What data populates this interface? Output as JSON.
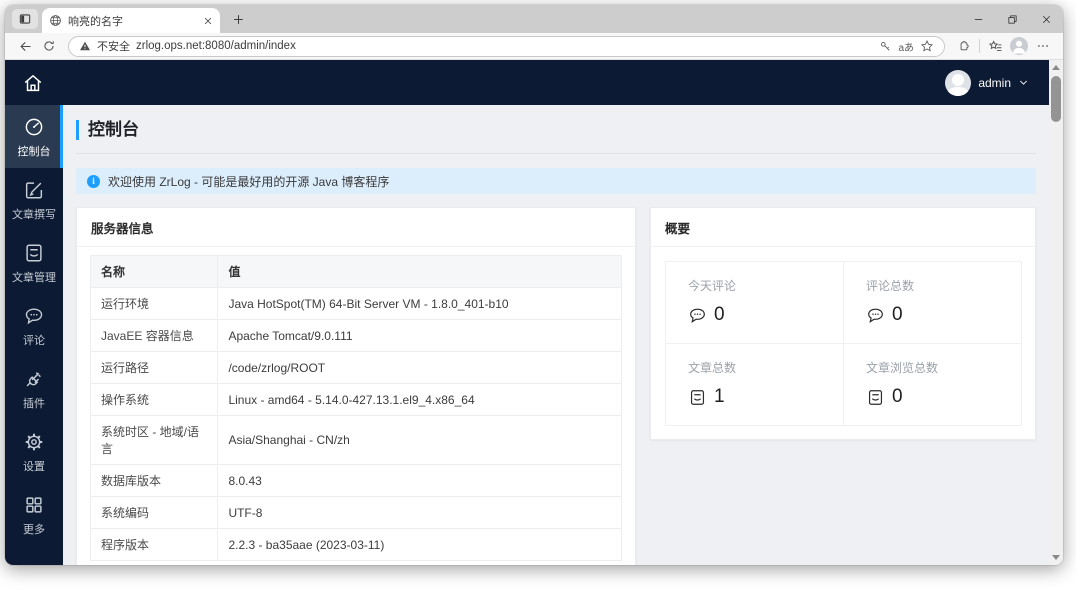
{
  "browser": {
    "tab_title": "响亮的名字",
    "security_label": "不安全",
    "url": "zrlog.ops.net:8080/admin/index",
    "translate_label": "aあ"
  },
  "app_header": {
    "user": "admin"
  },
  "sidebar": {
    "items": [
      {
        "label": "控制台",
        "icon": "gauge-icon",
        "active": true
      },
      {
        "label": "文章撰写",
        "icon": "edit-icon",
        "active": false
      },
      {
        "label": "文章管理",
        "icon": "articles-icon",
        "active": false
      },
      {
        "label": "评论",
        "icon": "comments-icon",
        "active": false
      },
      {
        "label": "插件",
        "icon": "plugin-icon",
        "active": false
      },
      {
        "label": "设置",
        "icon": "gear-icon",
        "active": false
      },
      {
        "label": "更多",
        "icon": "grid-icon",
        "active": false
      }
    ]
  },
  "main": {
    "page_title": "控制台",
    "notice": "欢迎使用 ZrLog - 可能是最好用的开源 Java 博客程序",
    "server_panel": {
      "title": "服务器信息",
      "columns": [
        "名称",
        "值"
      ],
      "rows": [
        [
          "运行环境",
          "Java HotSpot(TM) 64-Bit Server VM - 1.8.0_401-b10"
        ],
        [
          "JavaEE 容器信息",
          "Apache Tomcat/9.0.111"
        ],
        [
          "运行路径",
          "/code/zrlog/ROOT"
        ],
        [
          "操作系统",
          "Linux - amd64 - 5.14.0-427.13.1.el9_4.x86_64"
        ],
        [
          "系统时区 - 地域/语言",
          "Asia/Shanghai - CN/zh"
        ],
        [
          "数据库版本",
          "8.0.43"
        ],
        [
          "系统编码",
          "UTF-8"
        ],
        [
          "程序版本",
          "2.2.3 - ba35aae (2023-03-11)"
        ]
      ]
    },
    "overview_panel": {
      "title": "概要",
      "stats": [
        {
          "label": "今天评论",
          "value": "0",
          "icon": "comment-icon"
        },
        {
          "label": "评论总数",
          "value": "0",
          "icon": "comment-icon"
        },
        {
          "label": "文章总数",
          "value": "1",
          "icon": "article-icon"
        },
        {
          "label": "文章浏览总数",
          "value": "0",
          "icon": "article-icon"
        }
      ]
    }
  },
  "colors": {
    "accent_blue": "#1e9fff",
    "dark_navy": "#0c1b33",
    "active_item_bg": "#2a3a50",
    "banner_bg": "#dcedfb",
    "content_bg": "#eef0f3",
    "chrome_gray": "#cdcdcd"
  }
}
